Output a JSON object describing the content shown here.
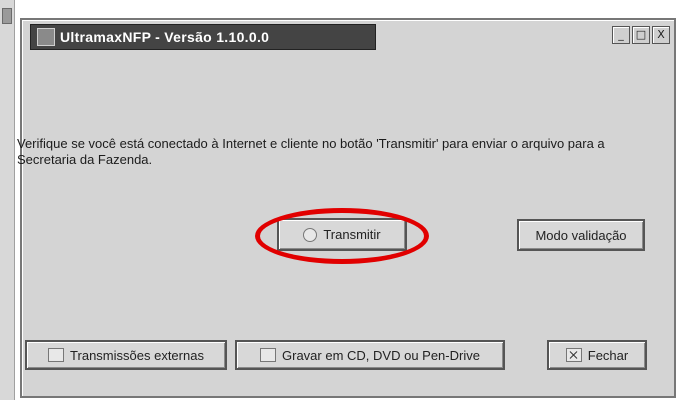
{
  "window": {
    "title": "UltramaxNFP - Versão 1.10.0.0",
    "controls": [
      "_",
      "□",
      "X"
    ]
  },
  "message": "Verifique se você está conectado à Internet e cliente no botão 'Transmitir' para enviar o arquivo para a Secretaria da Fazenda.",
  "buttons": {
    "transmitir": "Transmitir",
    "modo_validacao": "Modo validação",
    "transmissoes_externas": "Transmissões externas",
    "gravar": "Gravar em CD, DVD ou Pen-Drive",
    "fechar": "Fechar"
  },
  "annotation": {
    "highlight_color": "#e10000"
  }
}
